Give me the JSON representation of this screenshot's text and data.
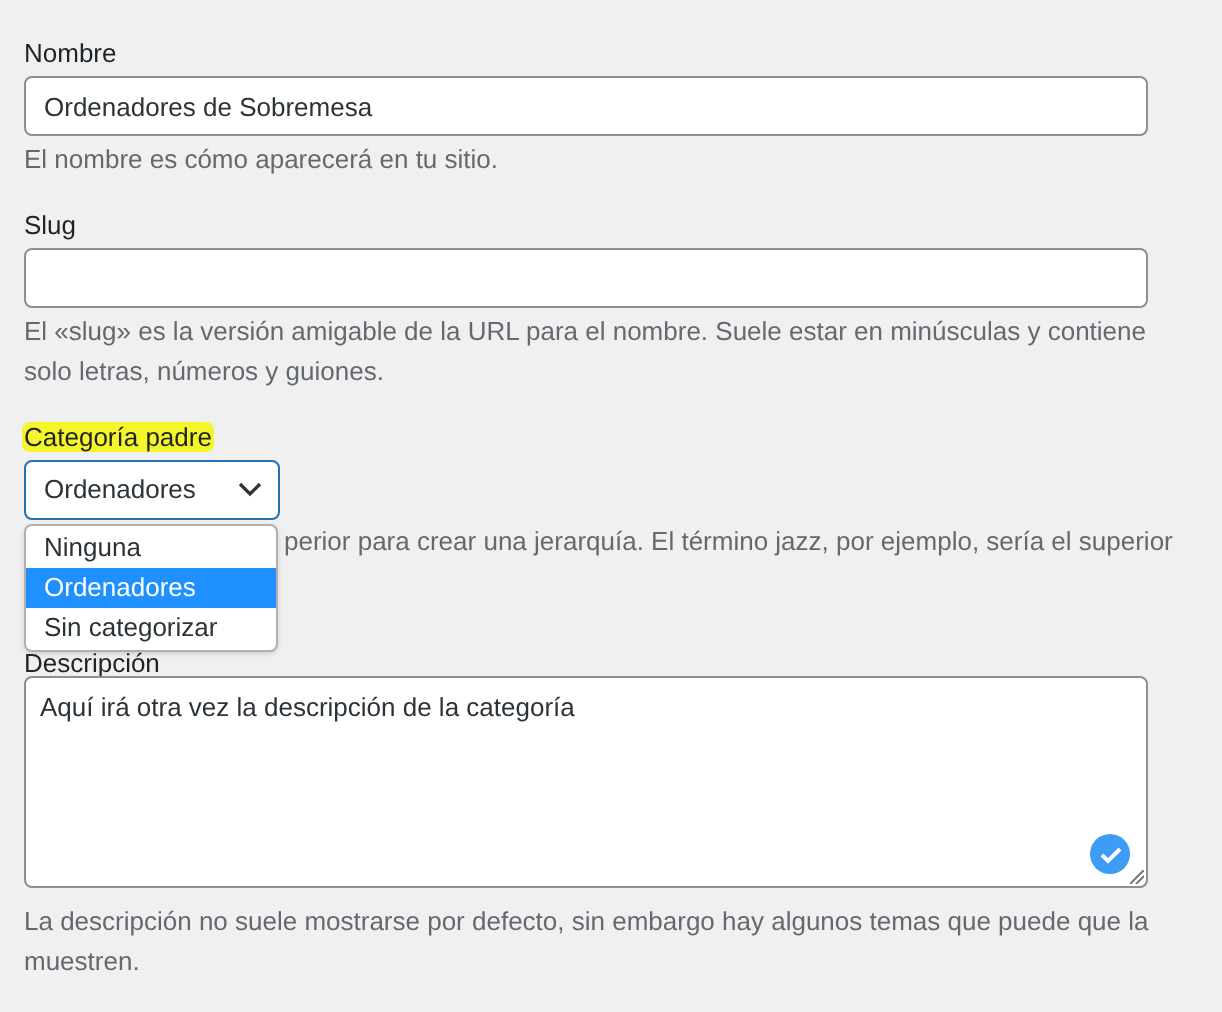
{
  "fields": [
    {
      "kind": "text",
      "label": "Nombre",
      "value": "Ordenadores de Sobremesa",
      "help": [
        "El nombre es cómo aparecerá en tu sitio."
      ]
    },
    {
      "kind": "text",
      "label": "Slug",
      "help": [
        "El «slug» es la versión amigable de la URL para el nombre. Suele estar en minúsculas y contiene",
        "solo letras, números y guiones."
      ]
    },
    {
      "kind": "select",
      "label": "Categoría padre",
      "highlighted": true,
      "value": "Ordenadores",
      "expanded": true,
      "options": [
        {
          "label": "Ninguna",
          "selected": false
        },
        {
          "label": "Ordenadores",
          "selected": true
        },
        {
          "label": "Sin categorizar",
          "selected": false
        }
      ],
      "help": [
        "perior para crear una jerarquía. El término jazz, por ejemplo, sería el superior"
      ]
    },
    {
      "kind": "textarea",
      "label": "Descripción",
      "value": "Aquí irá otra vez la descripción de la categoría",
      "valid": true,
      "help": [
        "La descripción no suele mostrarse por defecto, sin embargo hay algunos temas que puede que la",
        "muestren."
      ]
    }
  ]
}
